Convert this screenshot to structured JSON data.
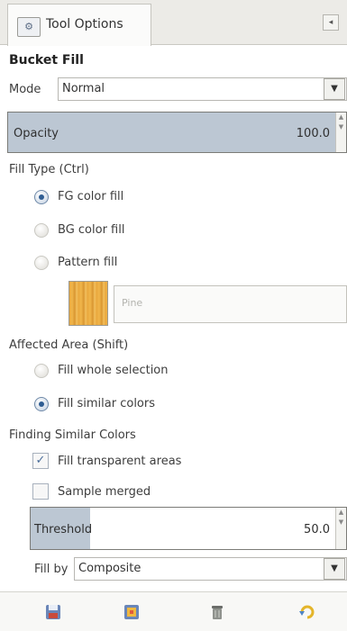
{
  "tab": {
    "label": "Tool Options",
    "icon": "tool-options-icon"
  },
  "panel_menu_button": {
    "icon": "panel-menu-icon"
  },
  "tool_title": "Bucket Fill",
  "mode": {
    "label": "Mode",
    "value": "Normal"
  },
  "opacity": {
    "label": "Opacity",
    "value": "100.0",
    "fraction": 1.0
  },
  "fill_type": {
    "label": "Fill Type  (Ctrl)",
    "options": [
      "FG color fill",
      "BG color fill",
      "Pattern fill"
    ],
    "selected": "FG color fill"
  },
  "pattern": {
    "name": "Pine"
  },
  "affected_area": {
    "label": "Affected Area  (Shift)",
    "options": [
      "Fill whole selection",
      "Fill similar colors"
    ],
    "selected": "Fill similar colors"
  },
  "similar_colors": {
    "label": "Finding Similar Colors",
    "fill_transparent": {
      "label": "Fill transparent areas",
      "checked": true
    },
    "sample_merged": {
      "label": "Sample merged",
      "checked": false
    },
    "threshold": {
      "label": "Threshold",
      "value": "50.0",
      "fraction": 0.196
    },
    "fill_by": {
      "label": "Fill by",
      "value": "Composite"
    }
  },
  "bottom_icons": [
    "save-options-icon",
    "restore-options-icon",
    "delete-options-icon",
    "reset-options-icon"
  ]
}
